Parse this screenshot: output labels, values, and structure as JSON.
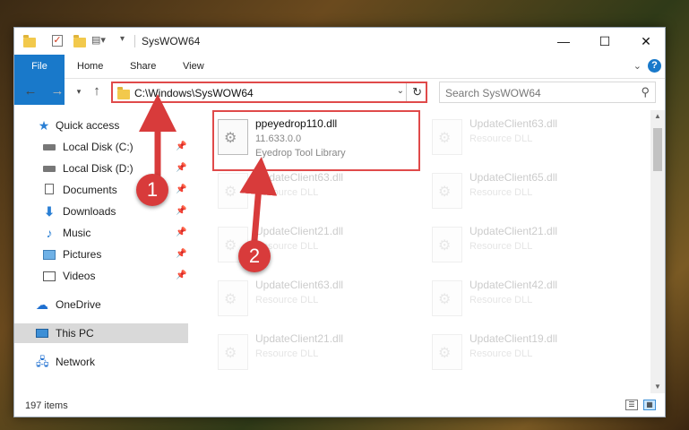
{
  "window": {
    "title": "SysWOW64",
    "controls": {
      "minimize": "—",
      "maximize": "☐",
      "close": "✕"
    }
  },
  "ribbon": {
    "tabs": [
      "File",
      "Home",
      "Share",
      "View"
    ],
    "expand_icon": "chevron-down-icon",
    "help": "?"
  },
  "nav": {
    "address": "C:\\Windows\\SysWOW64",
    "search_placeholder": "Search SysWOW64"
  },
  "sidebar": {
    "items": [
      {
        "label": "Quick access",
        "icon": "star-icon",
        "pinned": false
      },
      {
        "label": "Local Disk (C:)",
        "icon": "disk-icon",
        "pinned": true
      },
      {
        "label": "Local Disk (D:)",
        "icon": "disk-icon",
        "pinned": true
      },
      {
        "label": "Documents",
        "icon": "documents-icon",
        "pinned": true
      },
      {
        "label": "Downloads",
        "icon": "download-icon",
        "pinned": true
      },
      {
        "label": "Music",
        "icon": "music-icon",
        "pinned": true
      },
      {
        "label": "Pictures",
        "icon": "pictures-icon",
        "pinned": true
      },
      {
        "label": "Videos",
        "icon": "videos-icon",
        "pinned": true
      },
      {
        "label": "OneDrive",
        "icon": "cloud-icon",
        "pinned": false
      },
      {
        "label": "This PC",
        "icon": "computer-icon",
        "pinned": false,
        "selected": true
      },
      {
        "label": "Network",
        "icon": "network-icon",
        "pinned": false
      }
    ]
  },
  "files": [
    {
      "name": "ppeyedrop110.dll",
      "line2": "11.633.0.0",
      "line3": "Eyedrop Tool Library",
      "highlighted": true
    },
    {
      "name": "UpdateClient63.dll",
      "line2": "Resource DLL",
      "line3": ""
    },
    {
      "name": "UpdateClient63.dll",
      "line2": "Resource DLL",
      "line3": ""
    },
    {
      "name": "UpdateClient65.dll",
      "line2": "Resource DLL",
      "line3": ""
    },
    {
      "name": "UpdateClient21.dll",
      "line2": "Resource DLL",
      "line3": ""
    },
    {
      "name": "UpdateClient21.dll",
      "line2": "Resource DLL",
      "line3": ""
    },
    {
      "name": "UpdateClient63.dll",
      "line2": "Resource DLL",
      "line3": ""
    },
    {
      "name": "UpdateClient42.dll",
      "line2": "Resource DLL",
      "line3": ""
    },
    {
      "name": "UpdateClient21.dll",
      "line2": "Resource DLL",
      "line3": ""
    },
    {
      "name": "UpdateClient19.dll",
      "line2": "Resource DLL",
      "line3": ""
    }
  ],
  "status": {
    "count": "197 items"
  },
  "annotations": {
    "step1": "1",
    "step2": "2",
    "color": "#d83b3b"
  }
}
